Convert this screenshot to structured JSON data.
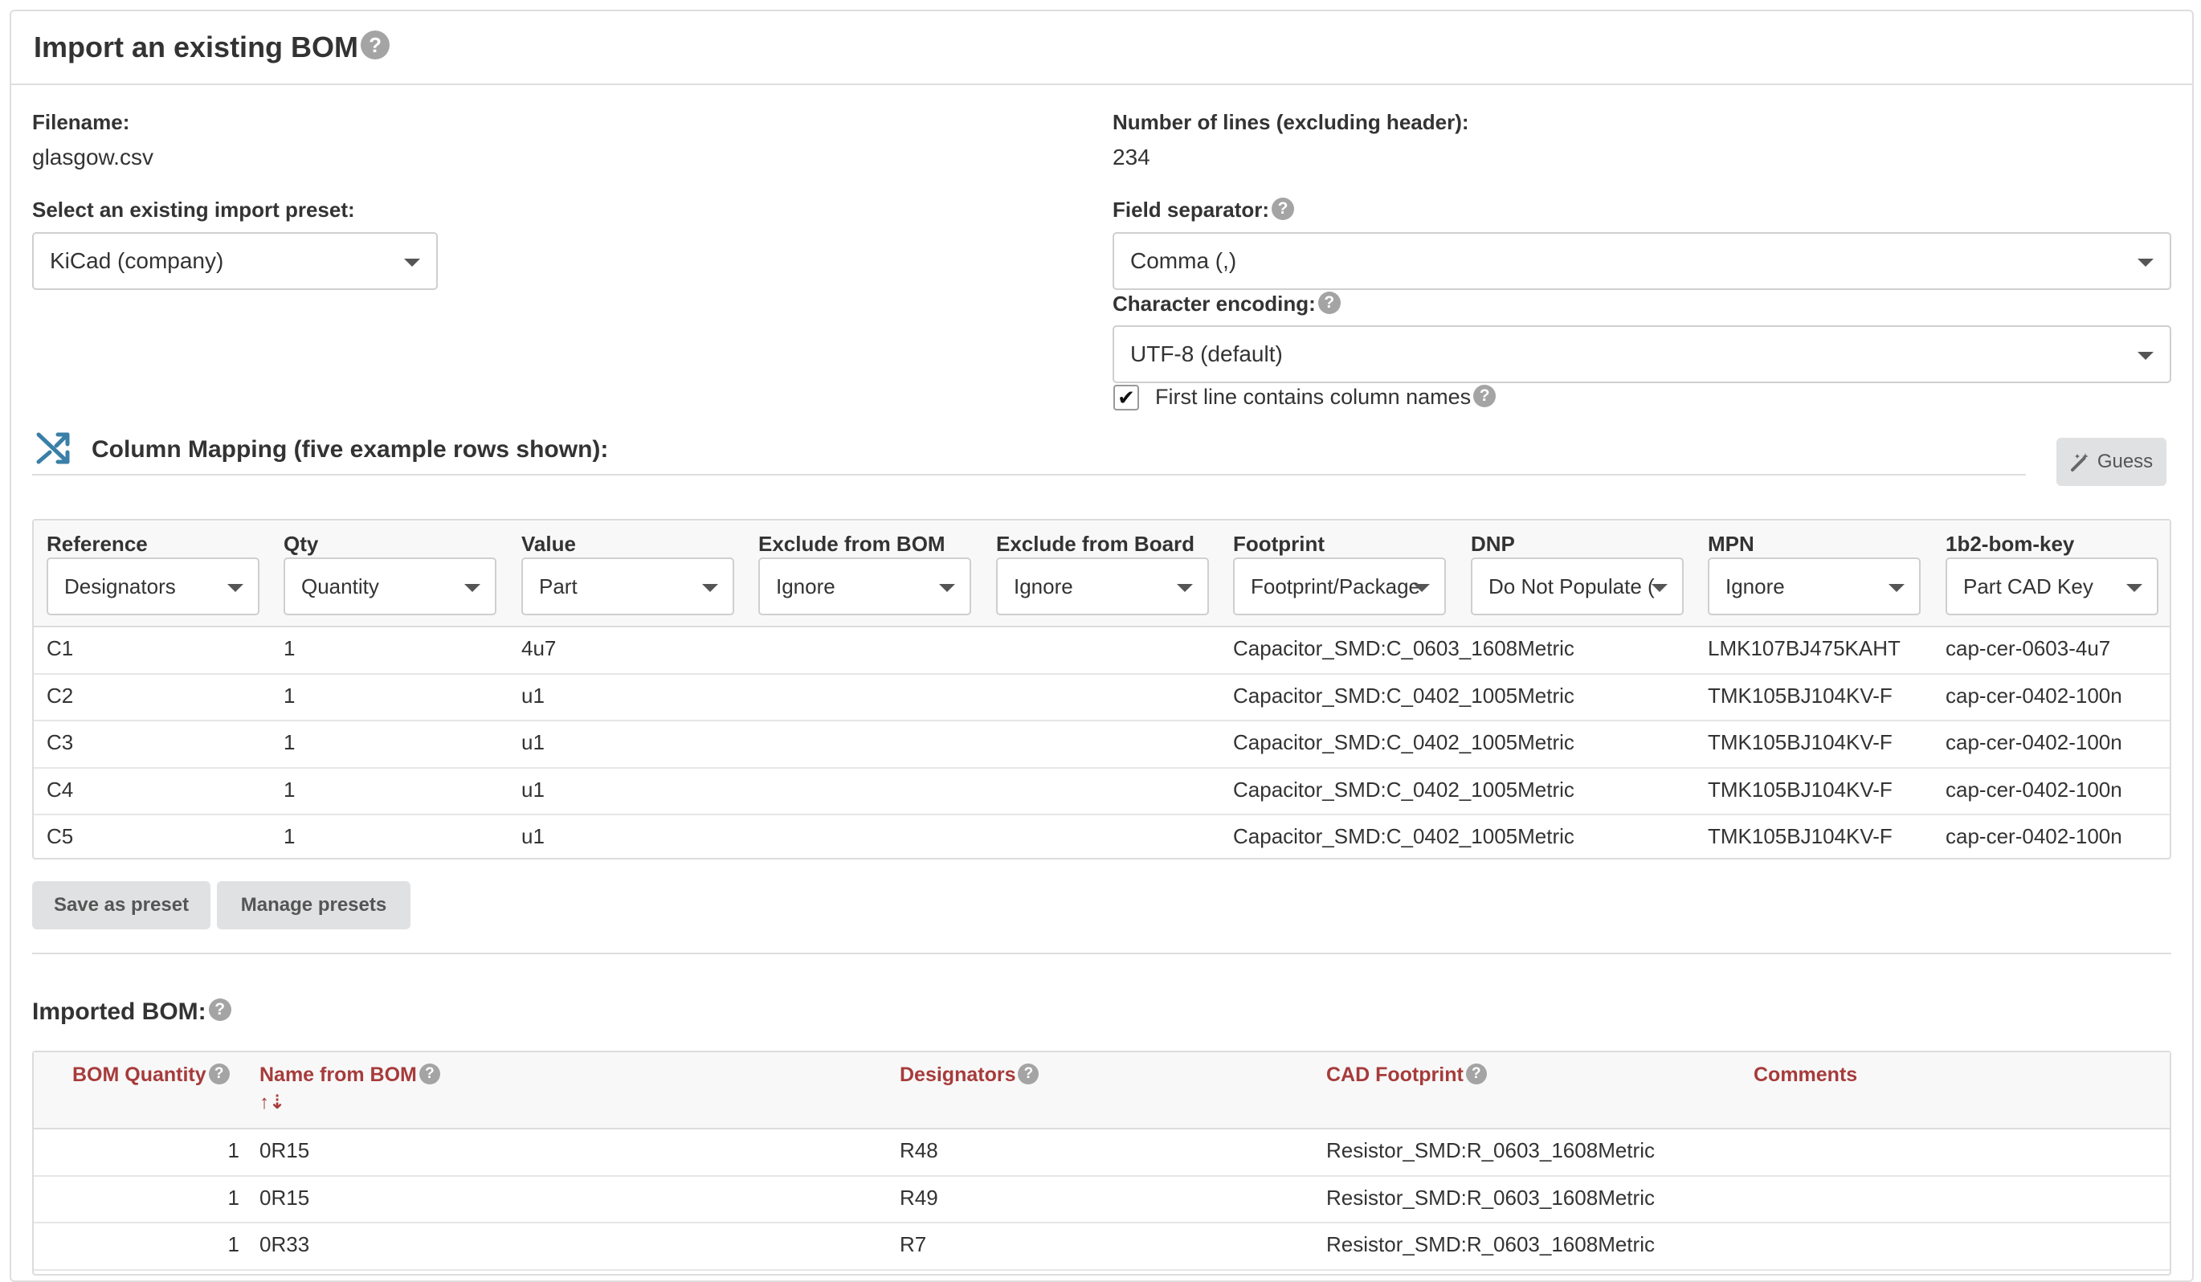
{
  "title": "Import an existing BOM",
  "help_glyph": "?",
  "filename": {
    "label": "Filename:",
    "value": "glasgow.csv"
  },
  "lines": {
    "label": "Number of lines (excluding header):",
    "value": "234"
  },
  "preset": {
    "label": "Select an existing import preset:",
    "value": "KiCad (company)"
  },
  "separator": {
    "label": "Field separator:",
    "value": "Comma (,)"
  },
  "encoding": {
    "label": "Character encoding:",
    "value": "UTF-8 (default)"
  },
  "first_line": {
    "label": "First line contains column names",
    "checked": true,
    "glyph": "✔"
  },
  "mapping": {
    "title": "Column Mapping (five example rows shown):",
    "guess_label": "Guess",
    "columns": [
      {
        "header": "Reference",
        "select": "Designators"
      },
      {
        "header": "Qty",
        "select": "Quantity"
      },
      {
        "header": "Value",
        "select": "Part"
      },
      {
        "header": "Exclude from BOM",
        "select": "Ignore"
      },
      {
        "header": "Exclude from Board",
        "select": "Ignore"
      },
      {
        "header": "Footprint",
        "select": "Footprint/Package"
      },
      {
        "header": "DNP",
        "select": "Do Not Populate ("
      },
      {
        "header": "MPN",
        "select": "Ignore"
      },
      {
        "header": "1b2-bom-key",
        "select": "Part CAD Key"
      }
    ],
    "rows": [
      [
        "C1",
        "1",
        "4u7",
        "",
        "",
        "Capacitor_SMD:C_0603_1608Metric",
        "",
        "LMK107BJ475KAHT",
        "cap-cer-0603-4u7"
      ],
      [
        "C2",
        "1",
        "u1",
        "",
        "",
        "Capacitor_SMD:C_0402_1005Metric",
        "",
        "TMK105BJ104KV-F",
        "cap-cer-0402-100n"
      ],
      [
        "C3",
        "1",
        "u1",
        "",
        "",
        "Capacitor_SMD:C_0402_1005Metric",
        "",
        "TMK105BJ104KV-F",
        "cap-cer-0402-100n"
      ],
      [
        "C4",
        "1",
        "u1",
        "",
        "",
        "Capacitor_SMD:C_0402_1005Metric",
        "",
        "TMK105BJ104KV-F",
        "cap-cer-0402-100n"
      ],
      [
        "C5",
        "1",
        "u1",
        "",
        "",
        "Capacitor_SMD:C_0402_1005Metric",
        "",
        "TMK105BJ104KV-F",
        "cap-cer-0402-100n"
      ]
    ],
    "save_preset": "Save as preset",
    "manage_presets": "Manage presets"
  },
  "imported": {
    "title": "Imported BOM:",
    "headers": {
      "qty": "BOM Quantity",
      "name": "Name from BOM",
      "designators": "Designators",
      "footprint": "CAD Footprint",
      "comments": "Comments"
    },
    "sort_glyph": "↑⇣",
    "rows": [
      {
        "qty": "1",
        "name": "0R15",
        "designators": "R48",
        "footprint": "Resistor_SMD:R_0603_1608Metric",
        "comments": ""
      },
      {
        "qty": "1",
        "name": "0R15",
        "designators": "R49",
        "footprint": "Resistor_SMD:R_0603_1608Metric",
        "comments": ""
      },
      {
        "qty": "1",
        "name": "0R33",
        "designators": "R7",
        "footprint": "Resistor_SMD:R_0603_1608Metric",
        "comments": ""
      }
    ]
  },
  "colors": {
    "accent_red": "#a73b3b",
    "icon_blue": "#3a7fa8"
  }
}
